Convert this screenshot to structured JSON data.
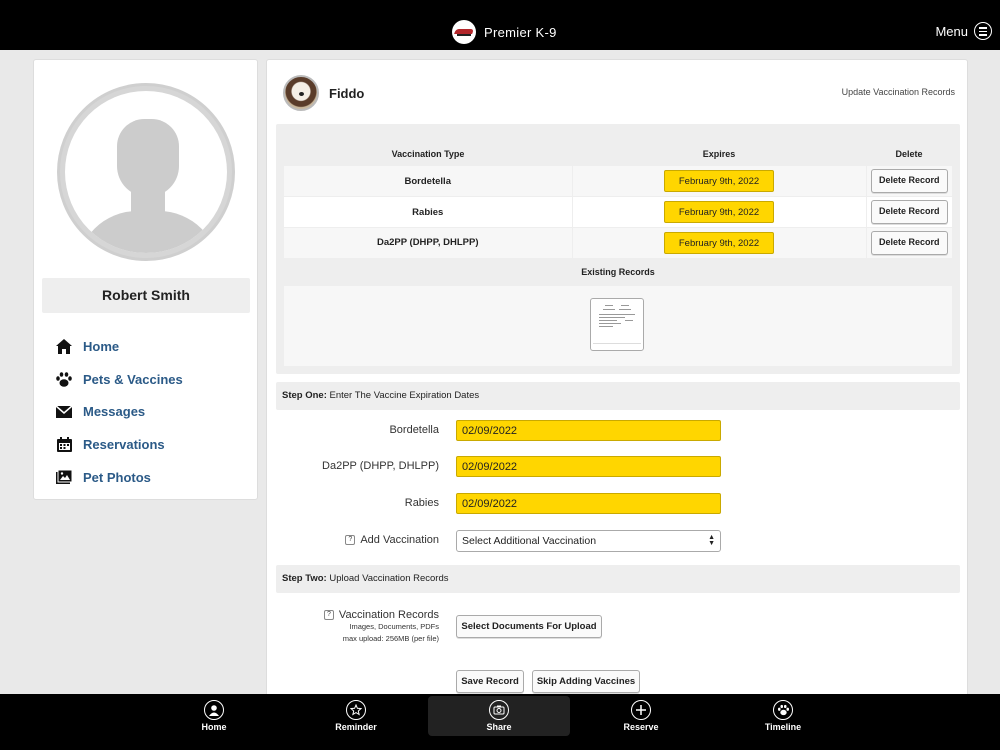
{
  "header": {
    "app_title": "Premier K-9",
    "menu_label": "Menu",
    "logo_icon": "premier-k9-logo",
    "menu_icon": "hamburger-circle-icon"
  },
  "profile": {
    "name": "Robert Smith",
    "avatar_icon": "default-user-silhouette"
  },
  "sidebar": {
    "items": [
      {
        "label": "Home",
        "icon": "home-icon"
      },
      {
        "label": "Pets & Vaccines",
        "icon": "paw-icon"
      },
      {
        "label": "Messages",
        "icon": "envelope-icon"
      },
      {
        "label": "Reservations",
        "icon": "calendar-icon"
      },
      {
        "label": "Pet Photos",
        "icon": "photos-icon"
      }
    ]
  },
  "pet": {
    "name": "Fiddo",
    "update_link": "Update Vaccination Records"
  },
  "vaccinations": {
    "headers": {
      "type": "Vaccination Type",
      "expires": "Expires",
      "delete": "Delete"
    },
    "rows": [
      {
        "type": "Bordetella",
        "expires": "February 9th, 2022",
        "delete_label": "Delete Record"
      },
      {
        "type": "Rabies",
        "expires": "February 9th, 2022",
        "delete_label": "Delete Record"
      },
      {
        "type": "Da2PP (DHPP, DHLPP)",
        "expires": "February 9th, 2022",
        "delete_label": "Delete Record"
      }
    ],
    "existing_records_title": "Existing Records"
  },
  "step_one": {
    "title_bold": "Step One:",
    "title_rest": " Enter The Vaccine Expiration Dates",
    "fields": [
      {
        "label": "Bordetella",
        "value": "02/09/2022"
      },
      {
        "label": "Da2PP (DHPP, DHLPP)",
        "value": "02/09/2022"
      },
      {
        "label": "Rabies",
        "value": "02/09/2022"
      }
    ],
    "add_vaccination_label": "Add Vaccination",
    "add_vaccination_select": "Select Additional Vaccination",
    "help_glyph": "?"
  },
  "step_two": {
    "title_bold": "Step Two:",
    "title_rest": " Upload Vaccination Records",
    "records_label": "Vaccination Records",
    "records_hint_1": "Images, Documents, PDFs",
    "records_hint_2": "max upload: 256MB (per file)",
    "select_button": "Select Documents For Upload"
  },
  "actions": {
    "save": "Save Record",
    "skip": "Skip Adding Vaccines"
  },
  "tabbar": {
    "tabs": [
      {
        "label": "Home",
        "icon": "user-circle-icon"
      },
      {
        "label": "Reminder",
        "icon": "star-circle-icon"
      },
      {
        "label": "Share",
        "icon": "camera-circle-icon"
      },
      {
        "label": "Reserve",
        "icon": "plus-circle-icon"
      },
      {
        "label": "Timeline",
        "icon": "paw-circle-icon"
      }
    ],
    "active_tab": "Share"
  },
  "colors": {
    "accent_yellow": "#ffd600",
    "nav_blue": "#2b5a87",
    "bar_black": "#000000"
  }
}
